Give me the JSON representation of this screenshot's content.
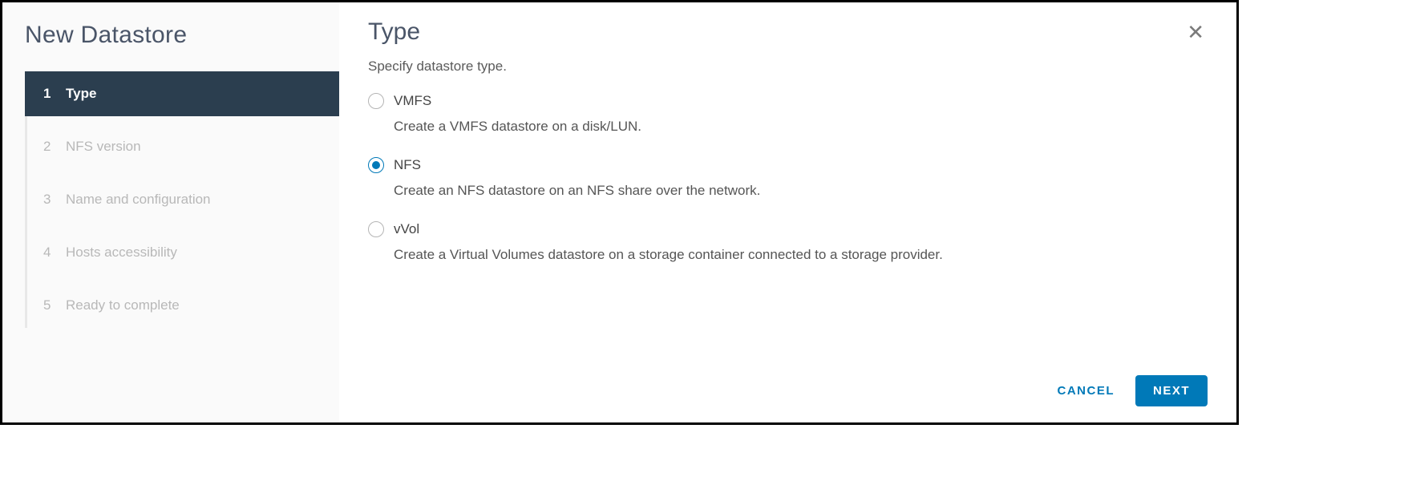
{
  "sidebar": {
    "title": "New Datastore",
    "steps": [
      {
        "num": "1",
        "label": "Type",
        "active": true
      },
      {
        "num": "2",
        "label": "NFS version",
        "active": false
      },
      {
        "num": "3",
        "label": "Name and configuration",
        "active": false
      },
      {
        "num": "4",
        "label": "Hosts accessibility",
        "active": false
      },
      {
        "num": "5",
        "label": "Ready to complete",
        "active": false
      }
    ]
  },
  "main": {
    "title": "Type",
    "subtitle": "Specify datastore type.",
    "options": [
      {
        "key": "vmfs",
        "label": "VMFS",
        "desc": "Create a VMFS datastore on a disk/LUN.",
        "selected": false
      },
      {
        "key": "nfs",
        "label": "NFS",
        "desc": "Create an NFS datastore on an NFS share over the network.",
        "selected": true
      },
      {
        "key": "vvol",
        "label": "vVol",
        "desc": "Create a Virtual Volumes datastore on a storage container connected to a storage provider.",
        "selected": false
      }
    ]
  },
  "footer": {
    "cancel": "CANCEL",
    "next": "NEXT"
  },
  "icons": {
    "close": "✕"
  }
}
